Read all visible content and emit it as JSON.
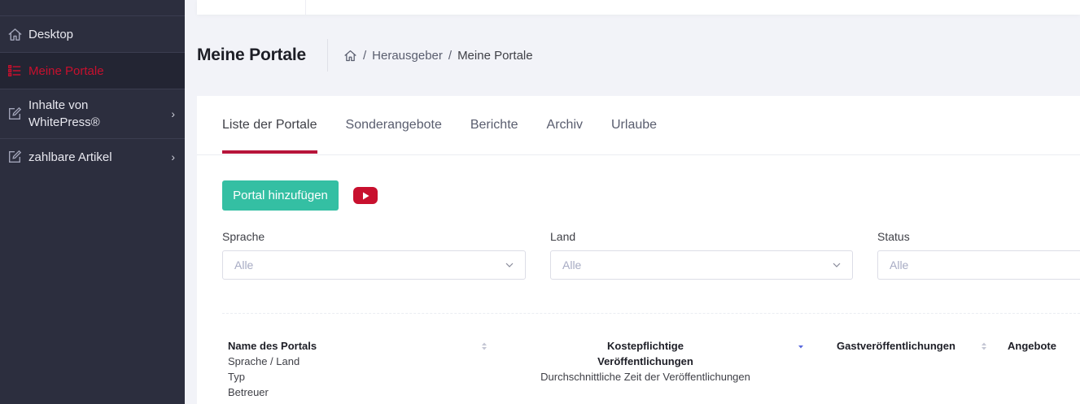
{
  "sidebar": {
    "items": [
      {
        "label": "Desktop",
        "icon": "home-icon"
      },
      {
        "label": "Meine Portale",
        "icon": "list-icon"
      },
      {
        "label": "Inhalte von WhitePress®",
        "icon": "edit-icon"
      },
      {
        "label": "zahlbare Artikel",
        "icon": "edit-icon"
      }
    ]
  },
  "header": {
    "title": "Meine Portale",
    "breadcrumb": [
      "Herausgeber",
      "Meine Portale"
    ]
  },
  "tabs": [
    "Liste der Portale",
    "Sonderangebote",
    "Berichte",
    "Archiv",
    "Urlaube"
  ],
  "actions": {
    "add_portal": "Portal hinzufügen"
  },
  "filters": [
    {
      "label": "Sprache",
      "value": "Alle"
    },
    {
      "label": "Land",
      "value": "Alle"
    },
    {
      "label": "Status",
      "value": "Alle"
    }
  ],
  "table": {
    "col1": {
      "title": "Name des Portals",
      "lines": [
        "Sprache / Land",
        "Typ",
        "Betreuer"
      ]
    },
    "col2": {
      "title_line1": "Kostepflichtige",
      "title_line2": "Veröffentlichungen",
      "sub": "Durchschnittliche Zeit der Veröffentlichungen"
    },
    "col3": {
      "title": "Gastveröffentlichungen"
    },
    "col4": {
      "title": "Angebote"
    }
  },
  "colors": {
    "accent": "#c8102e",
    "button": "#34bfa3",
    "sidebar": "#2c2e3e"
  }
}
